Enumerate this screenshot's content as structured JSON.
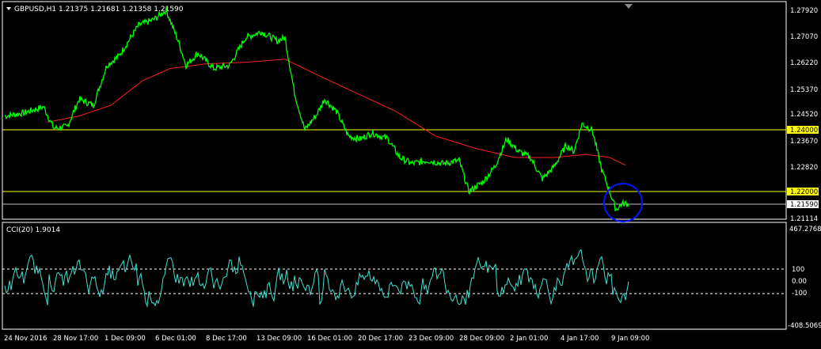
{
  "main_chart": {
    "header": "GBPUSD,H1  1.21375 1.21681 1.21358 1.21590",
    "price_levels": [
      "1.27920",
      "1.27070",
      "1.26220",
      "1.25370",
      "1.24520",
      "1.23670",
      "1.22820",
      "1.21975",
      "1.21114"
    ],
    "highlight_labels": [
      "1.24000",
      "1.22000"
    ],
    "current_price_label": "1.21590",
    "colors": {
      "price": "#00ff00",
      "ma": "#ff2020",
      "hline": "#ffff00",
      "cci": "#40e0d0",
      "circle": "#0018ff",
      "grid": "#ffffff"
    }
  },
  "indicator": {
    "header": "CCI(20) 1.9014",
    "levels": [
      "467.2768",
      "100",
      "0.00",
      "-100",
      "-408.5069"
    ]
  },
  "time_axis": [
    "24 Nov 2016",
    "28 Nov 17:00",
    "1 Dec 09:00",
    "6 Dec 01:00",
    "8 Dec 17:00",
    "13 Dec 09:00",
    "16 Dec 01:00",
    "20 Dec 17:00",
    "23 Dec 09:00",
    "28 Dec 09:00",
    "2 Jan 01:00",
    "4 Jan 17:00",
    "9 Jan 09:00"
  ],
  "chart_data": [
    {
      "type": "line",
      "title": "GBPUSD,H1",
      "x": [
        "24 Nov",
        "28 Nov",
        "1 Dec",
        "6 Dec",
        "8 Dec",
        "13 Dec",
        "16 Dec",
        "20 Dec",
        "23 Dec",
        "28 Dec",
        "2 Jan",
        "4 Jan",
        "9 Jan"
      ],
      "series": [
        {
          "name": "",
          "values": [
            1.2445,
            1.241,
            1.256,
            1.273,
            1.264,
            1.269,
            1.244,
            1.237,
            1.23,
            1.223,
            1.232,
            1.241,
            1.2159
          ]
        }
      ],
      "ylim": [
        1.21114,
        1.2792
      ]
    },
    {
      "type": "line",
      "title": "CCI(20) 1.9014",
      "ylim": [
        -408.5069,
        467.2768
      ]
    }
  ]
}
